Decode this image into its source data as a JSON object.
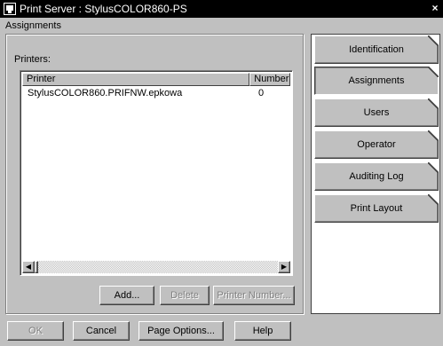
{
  "window": {
    "title": "Print Server : StylusCOLOR860-PS",
    "close_glyph": "×"
  },
  "section": {
    "title": "Assignments"
  },
  "printers": {
    "label": "Printers:",
    "columns": [
      "Printer",
      "Number"
    ],
    "rows": [
      {
        "printer": "StylusCOLOR860.PRIFNW.epkowa",
        "number": "0"
      }
    ]
  },
  "scroll": {
    "left_glyph": "◀",
    "right_glyph": "▶"
  },
  "list_buttons": {
    "add": "Add...",
    "delete": "Delete",
    "printer_number": "Printer Number..."
  },
  "footer": {
    "ok": "OK",
    "cancel": "Cancel",
    "page_options": "Page Options...",
    "help": "Help"
  },
  "pages": [
    {
      "label": "Identification"
    },
    {
      "label": "Assignments",
      "active": true
    },
    {
      "label": "Users"
    },
    {
      "label": "Operator"
    },
    {
      "label": "Auditing Log"
    },
    {
      "label": "Print Layout"
    }
  ]
}
